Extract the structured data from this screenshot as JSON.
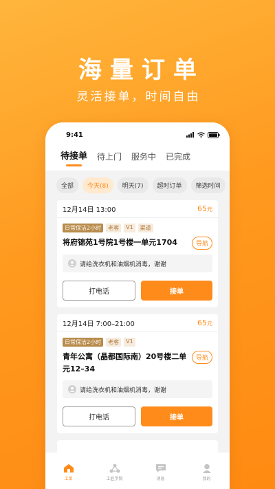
{
  "hero": {
    "title": "海量订单",
    "subtitle": "灵活接单，时间自由"
  },
  "status_bar": {
    "time": "9:41"
  },
  "tabs": [
    {
      "label": "待接单",
      "active": true
    },
    {
      "label": "待上门",
      "active": false
    },
    {
      "label": "服务中",
      "active": false
    },
    {
      "label": "已完成",
      "active": false
    }
  ],
  "filters": [
    {
      "label": "全部",
      "active": false
    },
    {
      "label": "今天(8)",
      "active": true
    },
    {
      "label": "明天(7)",
      "active": false
    },
    {
      "label": "超时订单",
      "active": false
    },
    {
      "label": "筛选时间",
      "active": false
    }
  ],
  "orders": [
    {
      "date": "12月14日  13:00",
      "price": "65",
      "price_unit": "元",
      "tags": [
        "日常保洁2小时",
        "老客",
        "V1",
        "渠道"
      ],
      "address": "将府锦苑1号院1号楼一单元1704",
      "nav_label": "导航",
      "note": "请给洗衣机和油烟机消毒，谢谢",
      "call_label": "打电话",
      "accept_label": "接单"
    },
    {
      "date": "12月14日  7:00–21:00",
      "price": "65",
      "price_unit": "元",
      "tags": [
        "日常保洁2小时",
        "老客",
        "V1"
      ],
      "address": "青年公寓（晶都国际南）20号楼二单元12–34",
      "nav_label": "导航",
      "note": "请给洗衣机和油烟机消毒，谢谢",
      "call_label": "打电话",
      "accept_label": "接单"
    }
  ],
  "bottom_nav": [
    {
      "label": "工单",
      "icon": "home-icon",
      "active": true
    },
    {
      "label": "工匠学院",
      "icon": "academy-icon",
      "active": false
    },
    {
      "label": "消息",
      "icon": "message-icon",
      "active": false
    },
    {
      "label": "我的",
      "icon": "profile-icon",
      "active": false
    }
  ],
  "colors": {
    "accent": "#FF8B1A",
    "tag_dark": "#B88B4A",
    "tag_light": "#F6EBDD"
  }
}
